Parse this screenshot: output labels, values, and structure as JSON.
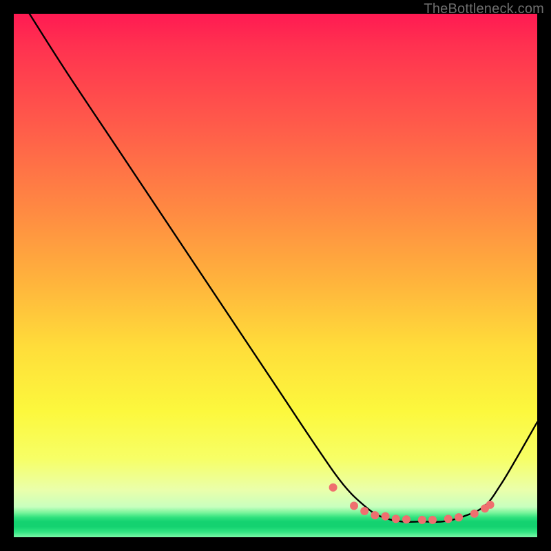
{
  "watermark": "TheBottleneck.com",
  "chart_data": {
    "type": "line",
    "title": "",
    "xlabel": "",
    "ylabel": "",
    "xlim": [
      0,
      100
    ],
    "ylim": [
      0,
      100
    ],
    "grid": false,
    "series": [
      {
        "name": "curve",
        "color": "#000000",
        "x": [
          3,
          10,
          20,
          30,
          40,
          50,
          58,
          63,
          67,
          70,
          74,
          78,
          82,
          86,
          90,
          93,
          96,
          100
        ],
        "values": [
          100,
          89,
          74,
          59,
          44,
          29,
          17,
          10,
          6,
          4,
          3,
          3,
          3,
          4,
          6,
          10,
          15,
          22
        ]
      }
    ],
    "markers": {
      "color": "#ef6f6f",
      "radius_px": 6,
      "x": [
        61,
        65,
        67,
        69,
        71,
        73,
        75,
        78,
        80,
        83,
        85,
        88,
        90,
        91
      ],
      "values": [
        9.5,
        6,
        5,
        4.2,
        4,
        3.5,
        3.4,
        3.3,
        3.3,
        3.5,
        3.8,
        4.5,
        5.5,
        6.2
      ]
    }
  }
}
